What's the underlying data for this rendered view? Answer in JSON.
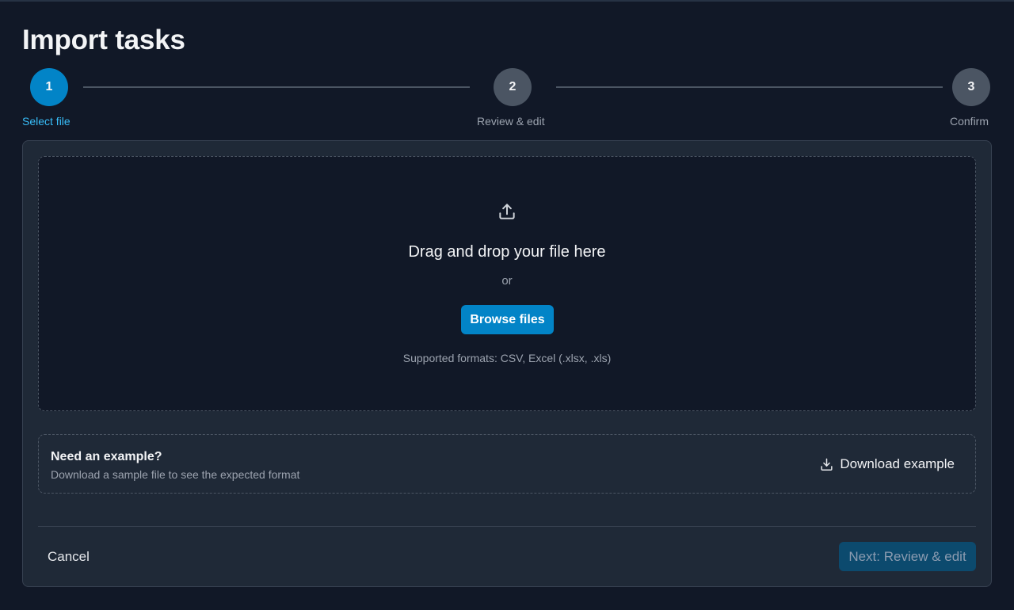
{
  "page": {
    "title": "Import tasks"
  },
  "stepper": {
    "steps": [
      {
        "number": "1",
        "label": "Select file",
        "state": "active"
      },
      {
        "number": "2",
        "label": "Review & edit",
        "state": "pending"
      },
      {
        "number": "3",
        "label": "Confirm",
        "state": "pending"
      }
    ]
  },
  "dropzone": {
    "icon": "upload-icon",
    "title": "Drag and drop your file here",
    "or_text": "or",
    "browse_label": "Browse files",
    "formats_text": "Supported formats: CSV, Excel (.xlsx, .xls)"
  },
  "example": {
    "title": "Need an example?",
    "subtitle": "Download a sample file to see the expected format",
    "download_icon": "download-icon",
    "download_label": "Download example"
  },
  "footer": {
    "cancel_label": "Cancel",
    "next_label": "Next: Review & edit",
    "next_disabled": true
  },
  "colors": {
    "background": "#111827",
    "card": "#1f2937",
    "accent": "#0284c7",
    "accent_text": "#38bdf8",
    "pending_step": "#4b5563",
    "disabled_button": "#0c4a6e"
  }
}
